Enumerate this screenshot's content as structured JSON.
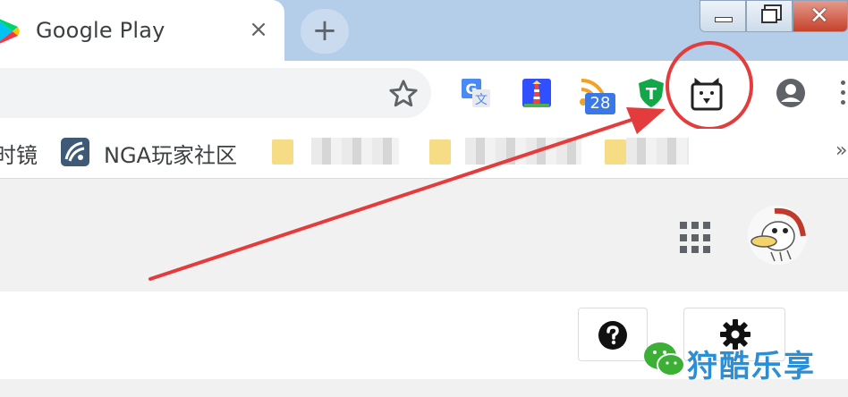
{
  "tab": {
    "title": "Google Play",
    "close_label": "×",
    "new_tab_label": "+"
  },
  "window_controls": [
    "minimize-button",
    "maximize-button",
    "close-button"
  ],
  "toolbar": {
    "extensions": [
      "google-translate-icon",
      "lighthouse-icon",
      "rss-feed-icon",
      "t-shield-icon",
      "bear-extension-icon"
    ],
    "rss_badge": "28"
  },
  "bookmarks": {
    "first_partial": "时镜",
    "nga_label": "NGA玩家社区",
    "more_label": "»"
  },
  "watermark": {
    "text": "狩酷乐享"
  },
  "annotation": {
    "circle_color": "#e43c3c",
    "arrow_color": "#e43c3c"
  }
}
